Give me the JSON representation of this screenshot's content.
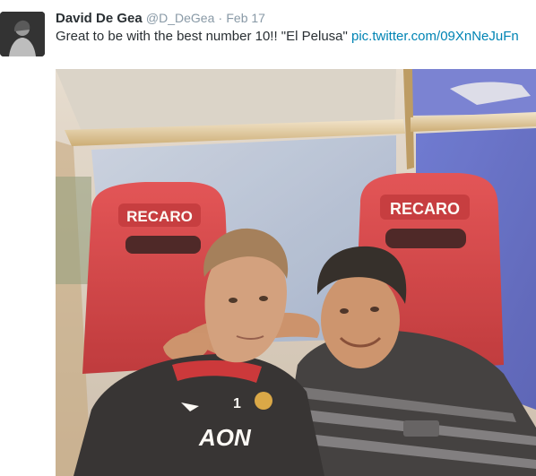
{
  "tweet": {
    "display_name": "David De Gea",
    "handle": "@D_DeGea",
    "separator": "·",
    "timestamp": "Feb 17",
    "text": "Great to be with the best number 10!! \"El Pelusa\"",
    "link": "pic.twitter.com/09XnNeJuFn"
  },
  "media": {
    "left_seat_logo": "RECARO",
    "right_seat_logo": "RECARO",
    "shirt_number": "1",
    "shirt_sponsor": "AON"
  },
  "colors": {
    "link": "#0084b4",
    "name": "#292f33",
    "meta": "#8899a6",
    "seat_red": "#d8343c"
  },
  "icons": {
    "avatar": "profile-photo",
    "media": "tweet-photo"
  }
}
